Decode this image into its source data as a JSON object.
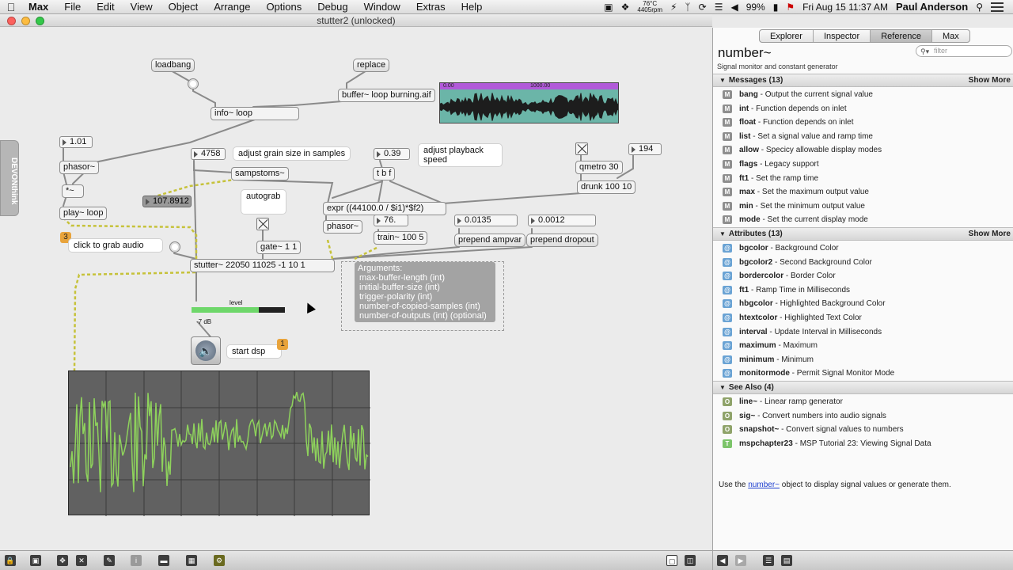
{
  "menubar": {
    "app": "Max",
    "menus": [
      "File",
      "Edit",
      "View",
      "Object",
      "Arrange",
      "Options",
      "Debug",
      "Window",
      "Extras",
      "Help"
    ],
    "temp": "76°C",
    "rpm": "4405rpm",
    "battery": "99%",
    "clock": "Fri Aug 15  11:37 AM",
    "user": "Paul Anderson"
  },
  "window": {
    "title": "stutter2 (unlocked)"
  },
  "patcher": {
    "devonthink": "DEVONthink",
    "objects": {
      "loadbang": "loadbang",
      "replace": "replace",
      "buffer": "buffer~ loop burning.aif",
      "info": "info~ loop",
      "phasor1": "phasor~",
      "tilde": "*~",
      "play": "play~ loop",
      "sampstoms": "sampstoms~",
      "tbf": "t b f",
      "qmetro": "qmetro 30",
      "drunk": "drunk 100 10",
      "expr": "expr ((44100.0 / $i1)*$f2)",
      "phasor2": "phasor~",
      "train": "train~ 100 5",
      "prepend_ampvar": "prepend ampvar",
      "prepend_dropout": "prepend dropout",
      "gate": "gate~ 1 1",
      "stutter": "stutter~ 22050 11025 -1 10 1",
      "autograb": "autograb",
      "start_dsp": "start dsp",
      "click_grab": "click to grab audio"
    },
    "numbers": {
      "n101": "1.01",
      "n4758": "4758",
      "n039": "0.39",
      "n194": "194",
      "n1078912": "107.8912",
      "n76": "76.",
      "n00135": "0.0135",
      "n00012": "0.0012"
    },
    "comments": {
      "grain": "adjust grain size in samples",
      "playback": "adjust playback speed"
    },
    "badges": {
      "b3": "3",
      "b1": "1"
    },
    "buffer_ruler": {
      "start": "0.00",
      "mid": "1000.00"
    },
    "meter": {
      "label": "level",
      "db": "-7 dB",
      "level_fraction": 0.72
    },
    "arguments": {
      "heading": "Arguments:",
      "items": [
        "max-buffer-length (int)",
        "initial-buffer-size (int)",
        "trigger-polarity (int)",
        "number-of-copied-samples (int)",
        "number-of-outputs (int) (optional)"
      ]
    }
  },
  "sidebar": {
    "tabs": [
      "Explorer",
      "Inspector",
      "Reference",
      "Max"
    ],
    "active_tab": "Reference",
    "filter_placeholder": "filter",
    "title": "number~",
    "subtitle": "Signal monitor and constant generator",
    "show_more": "Show More",
    "messages": {
      "header": "Messages (13)",
      "items": [
        {
          "name": "bang",
          "desc": " - Output the current signal value"
        },
        {
          "name": "int",
          "desc": " - Function depends on inlet"
        },
        {
          "name": "float",
          "desc": " - Function depends on inlet"
        },
        {
          "name": "list",
          "desc": " - Set a signal value and ramp time"
        },
        {
          "name": "allow",
          "desc": " - Specicy allowable display modes"
        },
        {
          "name": "flags",
          "desc": " - Legacy support"
        },
        {
          "name": "ft1",
          "desc": " - Set the ramp time"
        },
        {
          "name": "max",
          "desc": " - Set the maximum output value"
        },
        {
          "name": "min",
          "desc": " - Set the minimum output value"
        },
        {
          "name": "mode",
          "desc": " - Set the current display mode"
        }
      ]
    },
    "attributes": {
      "header": "Attributes (13)",
      "items": [
        {
          "name": "bgcolor",
          "desc": " - Background Color"
        },
        {
          "name": "bgcolor2",
          "desc": " - Second Background Color"
        },
        {
          "name": "bordercolor",
          "desc": " - Border Color"
        },
        {
          "name": "ft1",
          "desc": " - Ramp Time in Milliseconds"
        },
        {
          "name": "hbgcolor",
          "desc": " - Highlighted Background Color"
        },
        {
          "name": "htextcolor",
          "desc": " - Highlighted Text Color"
        },
        {
          "name": "interval",
          "desc": " - Update Interval in Milliseconds"
        },
        {
          "name": "maximum",
          "desc": " - Maximum"
        },
        {
          "name": "minimum",
          "desc": " - Minimum"
        },
        {
          "name": "monitormode",
          "desc": " - Permit Signal Monitor Mode"
        }
      ]
    },
    "seealso": {
      "header": "See Also (4)",
      "items": [
        {
          "name": "line~",
          "desc": " - Linear ramp generator",
          "icon": "O"
        },
        {
          "name": "sig~",
          "desc": " - Convert numbers into audio signals",
          "icon": "O"
        },
        {
          "name": "snapshot~",
          "desc": " - Convert signal values to numbers",
          "icon": "O"
        },
        {
          "name": "mspchapter23",
          "desc": " - MSP Tutorial 23: Viewing Signal Data",
          "icon": "T"
        }
      ]
    },
    "description": {
      "pre": "Use the ",
      "link": "number~",
      "post": " object to display signal values or generate them."
    }
  }
}
